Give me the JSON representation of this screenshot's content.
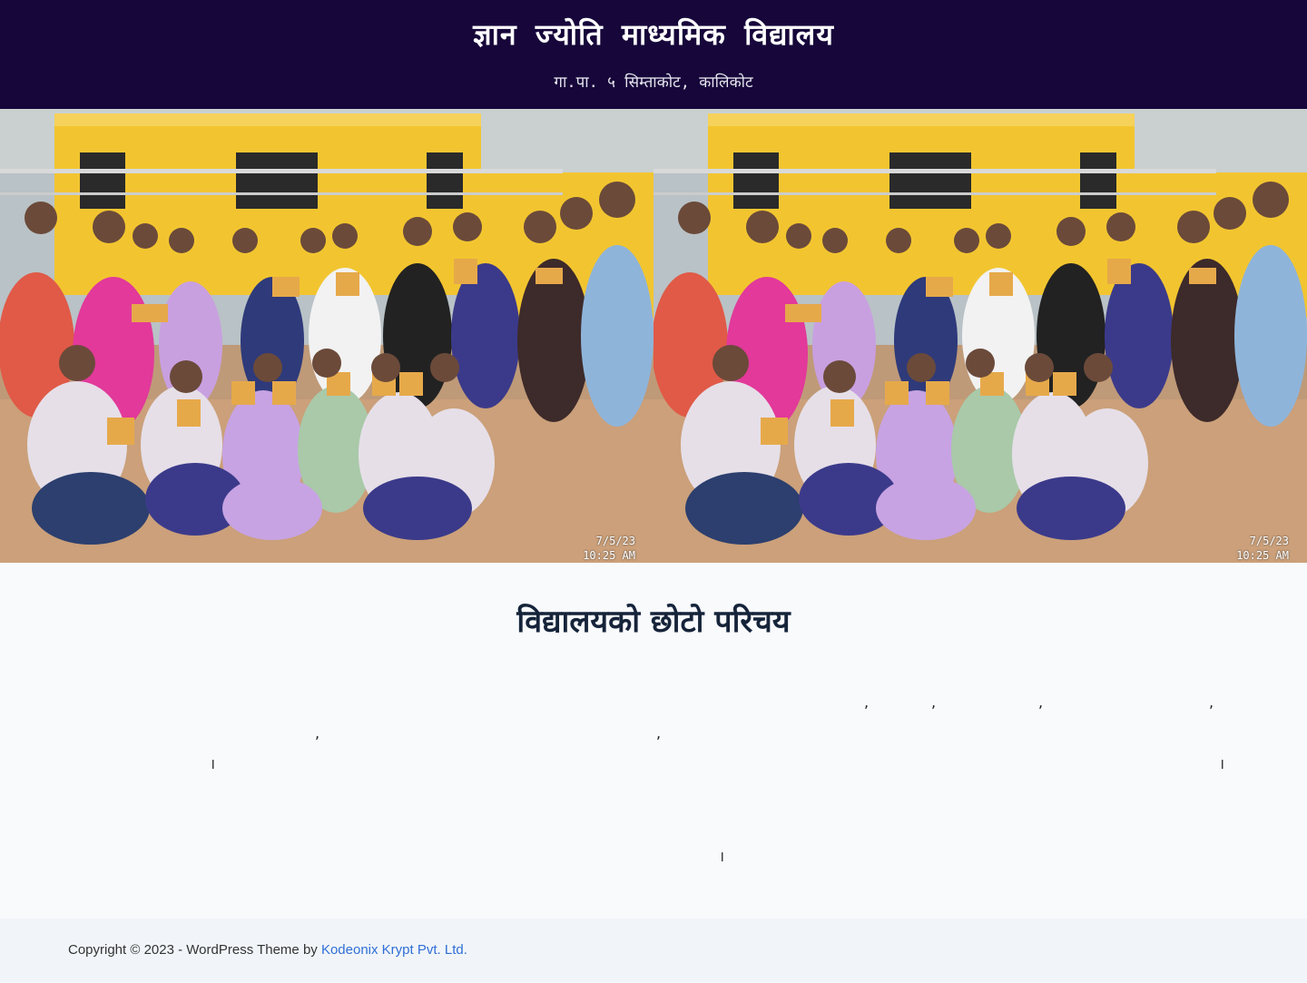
{
  "header": {
    "title": "ज्ञान ज्योति माध्यमिक विद्यालय",
    "tagline": "गा.पा. ५ सिम्ताकोट, कालिकोट"
  },
  "hero": {
    "photos": [
      {
        "stamp_date": "7/5/23",
        "stamp_time": "10:25 AM"
      },
      {
        "stamp_date": "7/5/23",
        "stamp_time": "10:25 AM"
      }
    ]
  },
  "intro": {
    "heading": "विद्यालयको छोटो परिचय",
    "punctuation": [
      ",",
      ",",
      ",",
      ",",
      ",",
      ",",
      "।",
      "।",
      "।"
    ]
  },
  "footer": {
    "copyright": "Copyright © 2023 - WordPress Theme by ",
    "link_text": "Kodeonix Krypt Pvt. Ltd."
  },
  "colors": {
    "header_bg": "#16063a",
    "footer_link": "#2f6fd6",
    "heading": "#16243a"
  }
}
